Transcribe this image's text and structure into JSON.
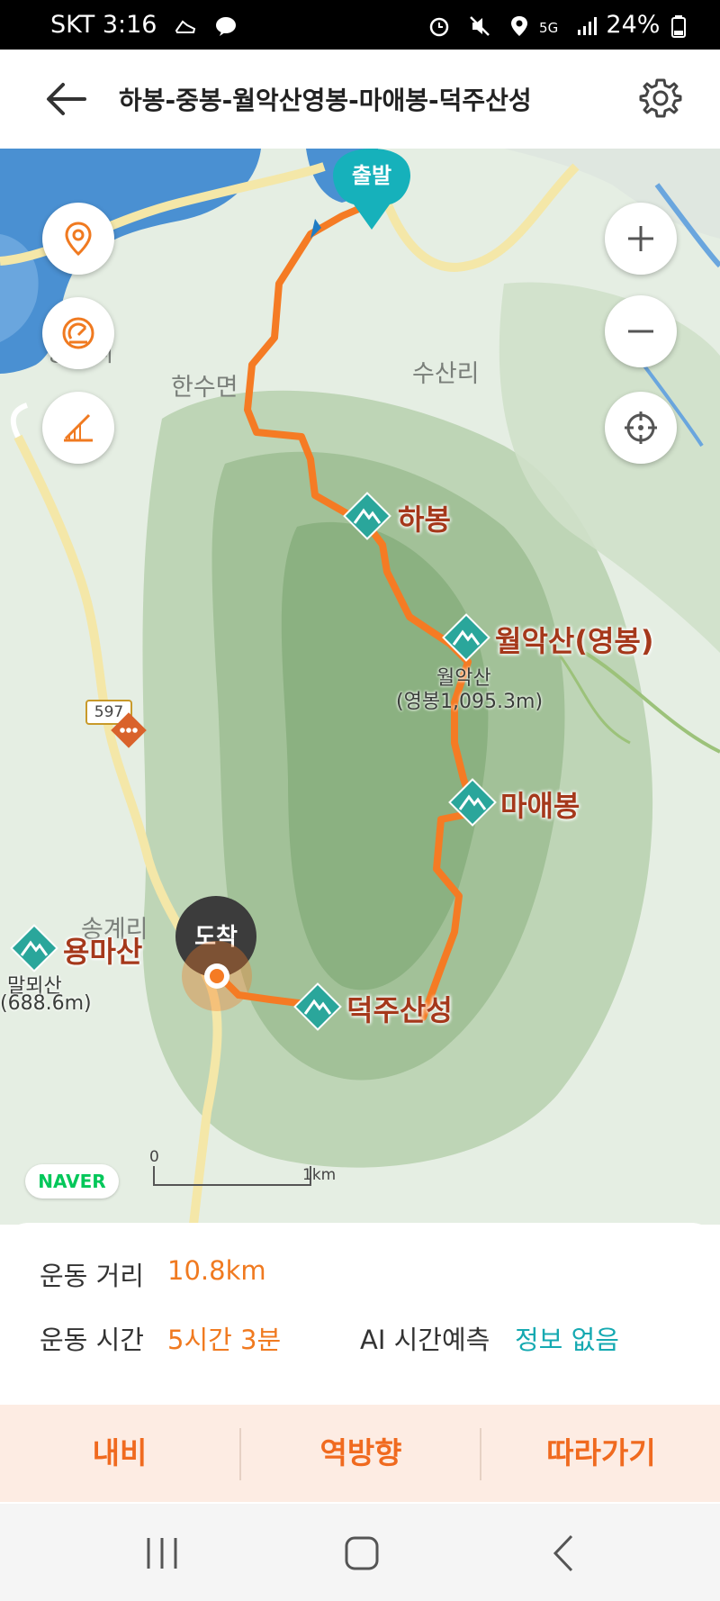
{
  "status_bar": {
    "carrier": "SKT",
    "time": "3:16",
    "network": "5G",
    "battery": "24%"
  },
  "header": {
    "title": "하봉-중봉-월악산영봉-마애봉-덕주산성"
  },
  "map": {
    "start_label": "출발",
    "end_label": "도착",
    "places": [
      "봉평리",
      "한수면",
      "수산리",
      "송계리"
    ],
    "peaks": [
      {
        "name": "하봉"
      },
      {
        "name": "월악산(영봉)",
        "sub1": "월악산",
        "sub2": "(영봉1,095.3m)"
      },
      {
        "name": "마애봉"
      },
      {
        "name": "덕주산성"
      },
      {
        "name": "용마산",
        "sub1": "말뫼산",
        "sub2": "(688.6m)"
      }
    ],
    "road_sign": "597",
    "provider": "NAVER",
    "scale_start": "0",
    "scale_end": "1km"
  },
  "stats": {
    "distance_label": "운동 거리",
    "distance_value": "10.8km",
    "time_label": "운동 시간",
    "time_value": "5시간 3분",
    "ai_label": "AI 시간예측",
    "ai_value": "정보 없음"
  },
  "actions": {
    "navi": "내비",
    "reverse": "역방향",
    "follow": "따라가기"
  },
  "colors": {
    "route": "#f57b24",
    "accent": "#f06a1f",
    "start_marker": "#16b1bb",
    "peak_marker": "#2aa69b"
  }
}
